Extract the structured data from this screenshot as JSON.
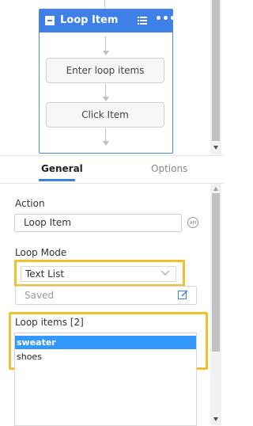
{
  "canvas": {
    "loop_card": {
      "title": "Loop Item",
      "steps": [
        "Enter loop items",
        "Click Item"
      ]
    }
  },
  "tabs": [
    {
      "label": "General",
      "active": true
    },
    {
      "label": "Options",
      "active": false
    }
  ],
  "properties": {
    "action_label": "Action",
    "action_value": "Loop Item",
    "api_icon_text": "API",
    "loop_mode_label": "Loop Mode",
    "loop_mode_value": "Text List",
    "saved_placeholder": "Saved",
    "loop_items_label": "Loop items [2]",
    "loop_items": [
      "sweater",
      "shoes"
    ],
    "selected_index": 0
  },
  "colors": {
    "accent": "#3f7fe8",
    "highlight": "#f0c12a",
    "selection": "#3399ff"
  }
}
